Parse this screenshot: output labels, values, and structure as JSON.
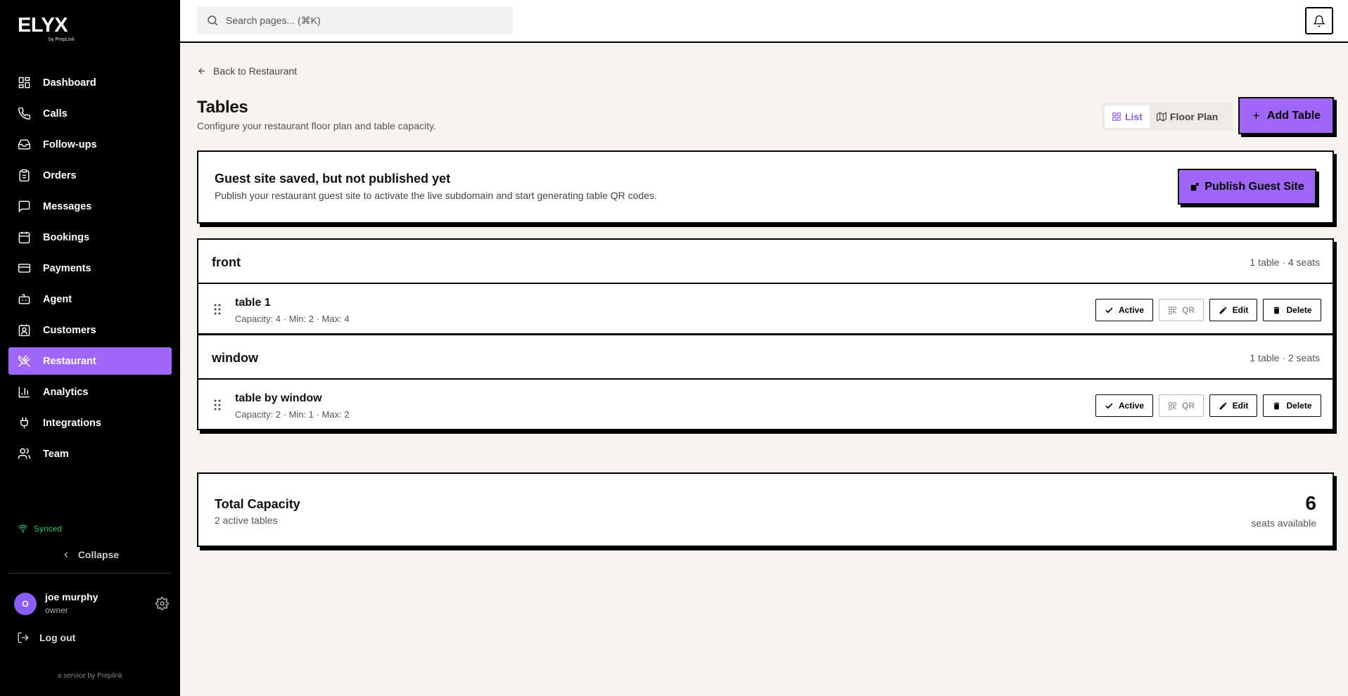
{
  "brand": {
    "name": "ELYX",
    "tagline": "by PrepLink"
  },
  "sidebar": {
    "items": [
      {
        "label": "Dashboard",
        "icon": "dashboard-icon"
      },
      {
        "label": "Calls",
        "icon": "phone-icon"
      },
      {
        "label": "Follow-ups",
        "icon": "inbox-icon"
      },
      {
        "label": "Orders",
        "icon": "clipboard-icon"
      },
      {
        "label": "Messages",
        "icon": "message-icon"
      },
      {
        "label": "Bookings",
        "icon": "calendar-icon"
      },
      {
        "label": "Payments",
        "icon": "credit-card-icon"
      },
      {
        "label": "Agent",
        "icon": "bot-icon"
      },
      {
        "label": "Customers",
        "icon": "contact-icon"
      },
      {
        "label": "Restaurant",
        "icon": "utensils-icon",
        "active": true
      },
      {
        "label": "Analytics",
        "icon": "bar-chart-icon"
      },
      {
        "label": "Integrations",
        "icon": "plug-icon"
      },
      {
        "label": "Team",
        "icon": "users-icon"
      }
    ],
    "status": "Synced",
    "collapse_label": "Collapse",
    "user": {
      "initial": "O",
      "name": "joe murphy",
      "role": "owner"
    },
    "logout_label": "Log out",
    "footer": "a service by Preplink"
  },
  "topbar": {
    "search_placeholder": "Search pages... (⌘K)"
  },
  "page": {
    "back_label": "Back to Restaurant",
    "title": "Tables",
    "subtitle": "Configure your restaurant floor plan and table capacity.",
    "view_list": "List",
    "view_floor": "Floor Plan",
    "add_table": "Add Table"
  },
  "notice": {
    "title": "Guest site saved, but not published yet",
    "text": "Publish your restaurant guest site to activate the live subdomain and start generating table QR codes.",
    "button": "Publish Guest Site"
  },
  "actions": {
    "active": "Active",
    "qr": "QR",
    "edit": "Edit",
    "delete": "Delete"
  },
  "sections": [
    {
      "name": "front",
      "meta": "1 table · 4 seats",
      "table": {
        "name": "table 1",
        "meta": "Capacity: 4 · Min: 2 · Max: 4"
      }
    },
    {
      "name": "window",
      "meta": "1 table · 2 seats",
      "table": {
        "name": "table by window",
        "meta": "Capacity: 2 · Min: 1 · Max: 2"
      }
    }
  ],
  "total": {
    "title": "Total Capacity",
    "sub": "2 active tables",
    "value": "6",
    "unit": "seats available"
  },
  "colors": {
    "accent": "#a066f8",
    "synced": "#22c55e",
    "background": "#f7f3ef"
  }
}
